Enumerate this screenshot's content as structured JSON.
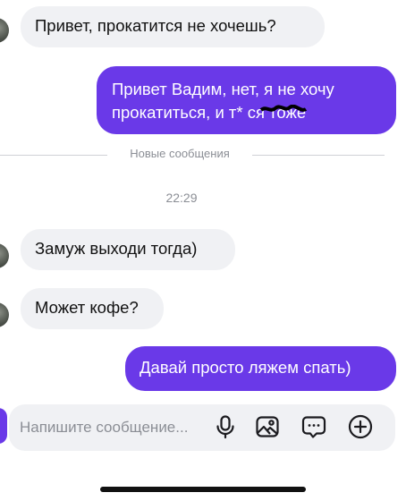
{
  "messages": [
    {
      "direction": "in",
      "text": "Привет, прокатится не хочешь?"
    },
    {
      "direction": "out",
      "lines": [
        "Привет Вадим, нет, я не хочу",
        "прокатиться,  и т* ся тоже"
      ]
    },
    {
      "direction": "in",
      "text": "Замуж выходи тогда)"
    },
    {
      "direction": "in",
      "text": "Может кофе?"
    },
    {
      "direction": "out",
      "text": "Давай просто ляжем спать)"
    }
  ],
  "divider": {
    "label": "Новые сообщения"
  },
  "timestamp": "22:29",
  "composer": {
    "placeholder": "Напишите сообщение..."
  },
  "icons": {
    "mic": "microphone-icon",
    "gallery": "image-icon",
    "sticker": "chat-bubble-icon",
    "add": "plus-circle-icon"
  },
  "colors": {
    "outgoing_bubble": "#6a39e8",
    "incoming_bubble": "#f0f1f4",
    "divider_text": "#8b8e95"
  }
}
